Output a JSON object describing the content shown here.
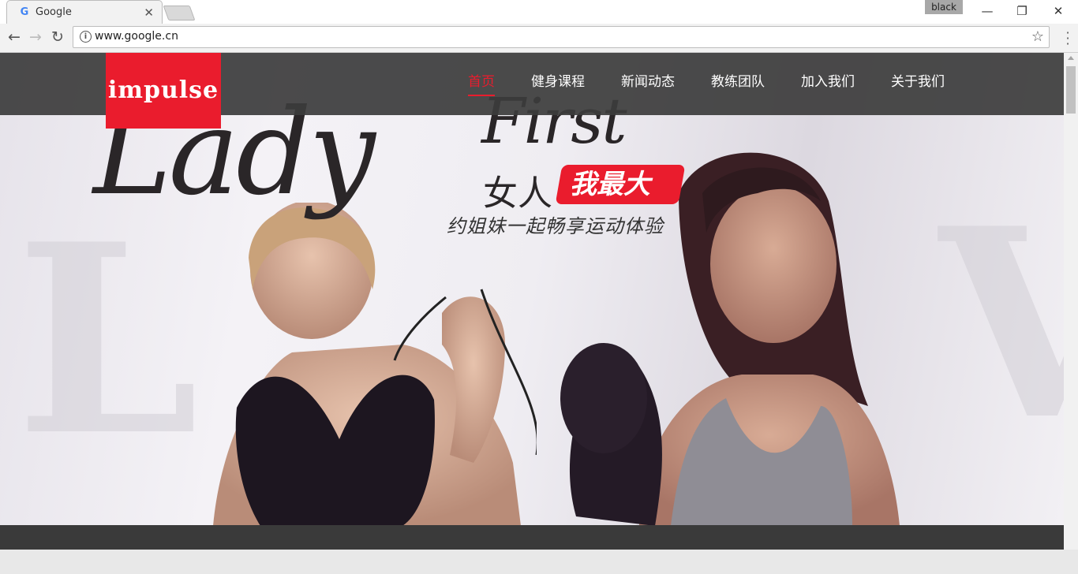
{
  "browser": {
    "tab_title": "Google",
    "tab_favicon": "google-g-icon",
    "close_tab_symbol": "✕",
    "profile_label": "black",
    "url": "www.google.cn",
    "window_controls": {
      "minimize": "—",
      "restore": "❐",
      "close": "✕"
    },
    "nav": {
      "back": "←",
      "forward": "→",
      "reload": "↻"
    },
    "star_symbol": "☆",
    "info_symbol": "i"
  },
  "site": {
    "logo": "impulse",
    "nav_items": [
      {
        "label": "首页",
        "active": true
      },
      {
        "label": "健身课程",
        "active": false
      },
      {
        "label": "新闻动态",
        "active": false
      },
      {
        "label": "教练团队",
        "active": false
      },
      {
        "label": "加入我们",
        "active": false
      },
      {
        "label": "关于我们",
        "active": false
      }
    ],
    "hero": {
      "script_text": "Lady",
      "script_text_2": "First",
      "slogan_main": "女人",
      "slogan_badge": "我最大",
      "slogan_sub": "约姐妹一起畅享运动体验"
    }
  },
  "colors": {
    "brand_red": "#ea1c2d",
    "header_bg": "#3c3c3c"
  }
}
